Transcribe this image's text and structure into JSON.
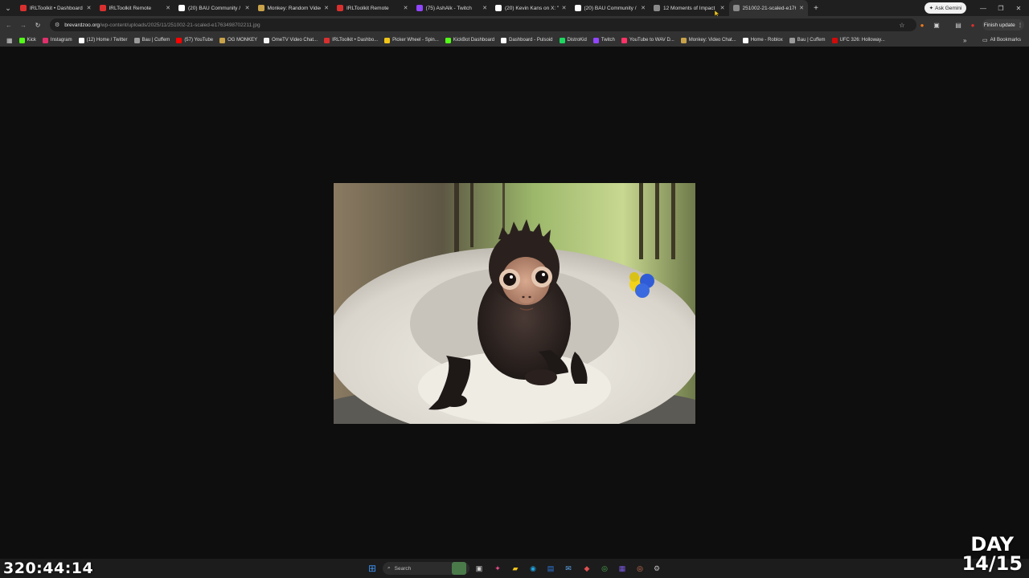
{
  "colors": {
    "page_bg": "#0e0e0e",
    "tabstrip_bg": "#1f1f1f",
    "toolbar_bg": "#323232",
    "taskbar_bg": "#1c1c1c"
  },
  "tabs": [
    {
      "title": "IRLToolkit • Dashboard",
      "icon": "irltoolkit-icon",
      "color": "#d9302f",
      "active": false
    },
    {
      "title": "IRLToolkit Remote",
      "icon": "irltoolkit-icon",
      "color": "#d9302f",
      "active": false
    },
    {
      "title": "(20) BAU Community / X",
      "icon": "x-icon",
      "color": "#ffffff",
      "active": false
    },
    {
      "title": "Monkey: Random Video",
      "icon": "monkey-icon",
      "color": "#c9a24a",
      "active": false
    },
    {
      "title": "IRLToolkit Remote",
      "icon": "irltoolkit-icon",
      "color": "#d9302f",
      "active": false
    },
    {
      "title": "(75) AshAlk - Twitch",
      "icon": "twitch-icon",
      "color": "#9146ff",
      "active": false
    },
    {
      "title": "(20) Kevin Kans on X: \"F",
      "icon": "x-icon",
      "color": "#ffffff",
      "active": false
    },
    {
      "title": "(20) BAU Community / X",
      "icon": "x-icon",
      "color": "#ffffff",
      "active": false
    },
    {
      "title": "12 Moments of Impact",
      "icon": "globe-icon",
      "color": "#8a8a8a",
      "active": false
    },
    {
      "title": "251002-21-scaled-e17634",
      "icon": "globe-icon",
      "color": "#8a8a8a",
      "active": true
    }
  ],
  "gemini_label": "Ask Gemini",
  "address": {
    "domain": "brevardzoo.org",
    "path": "/wp-content/uploads/2025/11/251002-21-scaled-e1763498702211.jpg"
  },
  "finish_update_label": "Finish update",
  "bookmarks": [
    {
      "label": "Kick",
      "color": "#53fc18"
    },
    {
      "label": "Instagram",
      "color": "#e1306c"
    },
    {
      "label": "(12) Home / Twitter",
      "color": "#ffffff"
    },
    {
      "label": "Bau | Cuffem",
      "color": "#9a9a9a"
    },
    {
      "label": "(57) YouTube",
      "color": "#ff0000"
    },
    {
      "label": "OG MONKEY",
      "color": "#c9a24a"
    },
    {
      "label": "OmeTV Video Chat...",
      "color": "#f5f5f5"
    },
    {
      "label": "IRLToolkit • Dashbo...",
      "color": "#d9302f"
    },
    {
      "label": "Picker Wheel - Spin...",
      "color": "#f0c419"
    },
    {
      "label": "KickBot Dashboard",
      "color": "#53fc18"
    },
    {
      "label": "Dashboard - Pulsoid",
      "color": "#ffffff"
    },
    {
      "label": "DistroKid",
      "color": "#1ed760"
    },
    {
      "label": "Twitch",
      "color": "#9146ff"
    },
    {
      "label": "YouTube to WAV D...",
      "color": "#ff3366"
    },
    {
      "label": "Monkey: Video Chat...",
      "color": "#c9a24a"
    },
    {
      "label": "Home - Roblox",
      "color": "#ffffff"
    },
    {
      "label": "Bau | Cuffem",
      "color": "#9a9a9a"
    },
    {
      "label": "UFC 326: Holloway...",
      "color": "#d20a0a"
    }
  ],
  "all_bookmarks_label": "All Bookmarks",
  "taskbar": {
    "search_placeholder": "Search"
  },
  "overlay": {
    "timer": "320:44:14",
    "day_line1": "DAY",
    "day_line2": "14/15"
  }
}
